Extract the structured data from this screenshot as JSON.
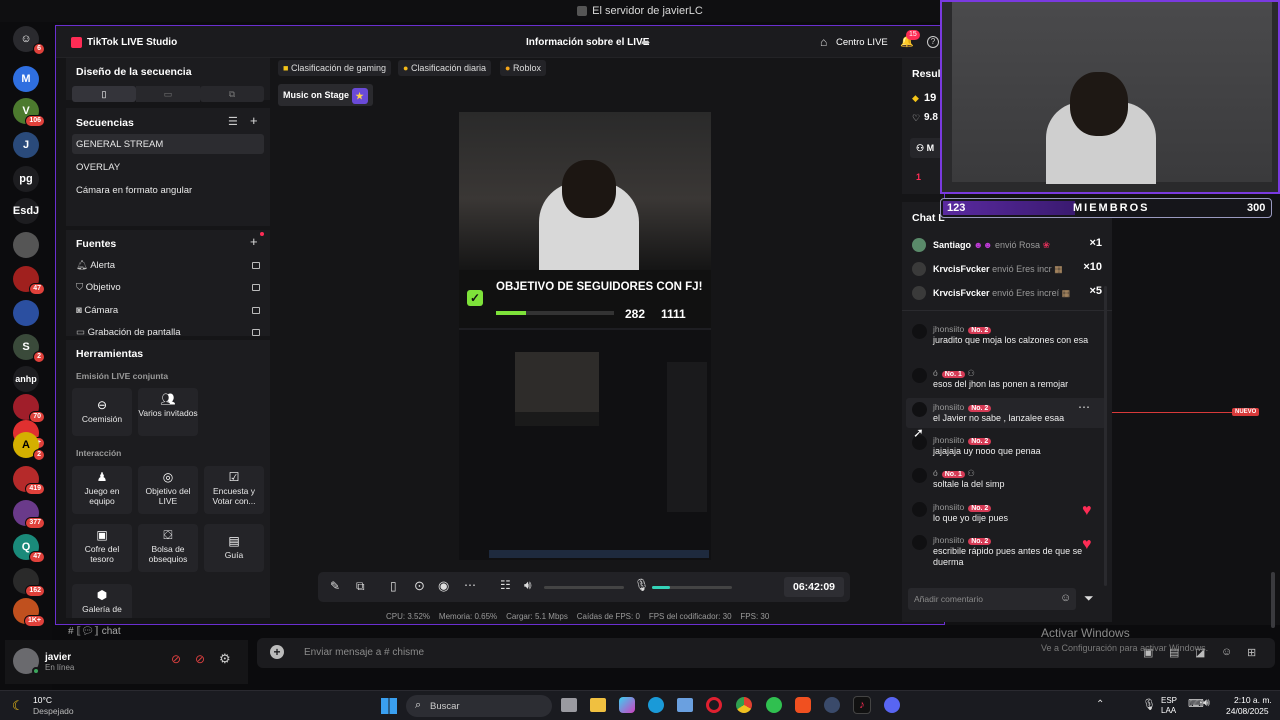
{
  "window_title": "El servidor de javierLC",
  "studio": {
    "app_name": "TikTok LIVE Studio",
    "header_center": "Información sobre el LIVE",
    "centro_live": "Centro LIVE",
    "notif_count": "15"
  },
  "left": {
    "design_title": "Diseño de la secuencia",
    "sequences_title": "Secuencias",
    "sequences": [
      "GENERAL STREAM",
      "OVERLAY",
      "Cámara en formato angular"
    ],
    "sources_title": "Fuentes",
    "sources": [
      "Alerta",
      "Objetivo",
      "Cámara",
      "Grabación de pantalla"
    ],
    "tools_title": "Herramientas",
    "joint_title": "Emisión LIVE conjunta",
    "joint": [
      "Coemisión",
      "Varios invitados"
    ],
    "interaction_title": "Interacción",
    "interaction": [
      "Juego en equipo",
      "Objetivo del LIVE",
      "Encuesta y Votar con...",
      "Cofre del tesoro",
      "Bolsa de obsequios",
      "Guía",
      "Galería de"
    ]
  },
  "chips": [
    "Clasificación de gaming",
    "Clasificación diaria",
    "Roblox",
    "Music on Stage"
  ],
  "preview": {
    "goal_title": "OBJETIVO DE SEGUIDORES CON FJ!",
    "goal_current": "282",
    "goal_total": "1111",
    "goal_progress": 0.254
  },
  "controls": {
    "timer": "06:42:09",
    "volume_level": 0.0,
    "mic_level": 0.22
  },
  "stats": {
    "cpu": "CPU: 3.52%",
    "memory": "Memoria: 0.65%",
    "load": "Cargar: 5.1 Mbps",
    "fps_drops": "Caídas de FPS: 0",
    "fps_encoder": "FPS del codificador: 30",
    "fps": "FPS: 30"
  },
  "right": {
    "results_title": "Result",
    "stat1": "19",
    "stat2": "9.8",
    "m_label": "M",
    "rank": "1",
    "chat_title": "Chat L",
    "gifts": [
      {
        "name": "Santiago",
        "action": "envió Rosa",
        "count": "×1"
      },
      {
        "name": "KrvcisFvcker",
        "action": "envió Eres incr",
        "count": "×10"
      },
      {
        "name": "KrvcisFvcker",
        "action": "envió Eres increí",
        "count": "×5"
      }
    ],
    "messages": [
      {
        "user": "jhonsiito",
        "level": "No. 2",
        "text": "juradito que moja los calzones con esa"
      },
      {
        "user": "ó",
        "level": "No. 1",
        "text": "esos del jhon las ponen a remojar"
      },
      {
        "user": "jhonsiito",
        "level": "No. 2",
        "text": "el Javier no sabe , lanzalee esaa"
      },
      {
        "user": "jhonsiito",
        "level": "No. 2",
        "text": "jajajaja uy nooo que penaa"
      },
      {
        "user": "ó",
        "level": "No. 1",
        "text": "soltale la del simp"
      },
      {
        "user": "jhonsiito",
        "level": "No. 2",
        "text": "lo que yo dije pues"
      },
      {
        "user": "jhonsiito",
        "level": "No. 2",
        "text": "escribile rápido pues antes de que se duerma"
      }
    ],
    "comment_placeholder": "Añadir comentario"
  },
  "overlay": {
    "members_left": "123",
    "members_label": "MIEMBROS",
    "members_right": "300"
  },
  "discord": {
    "channel": "chat",
    "message_placeholder": "Enviar mensaje a #  chisme",
    "username": "javier",
    "status": "En línea",
    "nuevo": "NUEVO",
    "activate_title": "Activar Windows",
    "activate_sub": "Ve a Configuración para activar Windows."
  },
  "taskbar": {
    "weather_temp": "10°C",
    "weather_desc": "Despejado",
    "search": "Buscar",
    "lang": "ESP",
    "lang2": "LAA",
    "time": "2:10 a. m.",
    "date": "24/08/2025"
  },
  "server_badges": [
    "6",
    "106",
    "47",
    "2",
    "70",
    "1K+",
    "2",
    "419",
    "377",
    "47",
    "162",
    "1K+"
  ],
  "server_labels": [
    "pg",
    "EsdJ",
    "anhp"
  ],
  "colors": {
    "accent": "#6a2fd0",
    "tiktok_red": "#fe2c55",
    "goal_green": "#7ee23a"
  }
}
